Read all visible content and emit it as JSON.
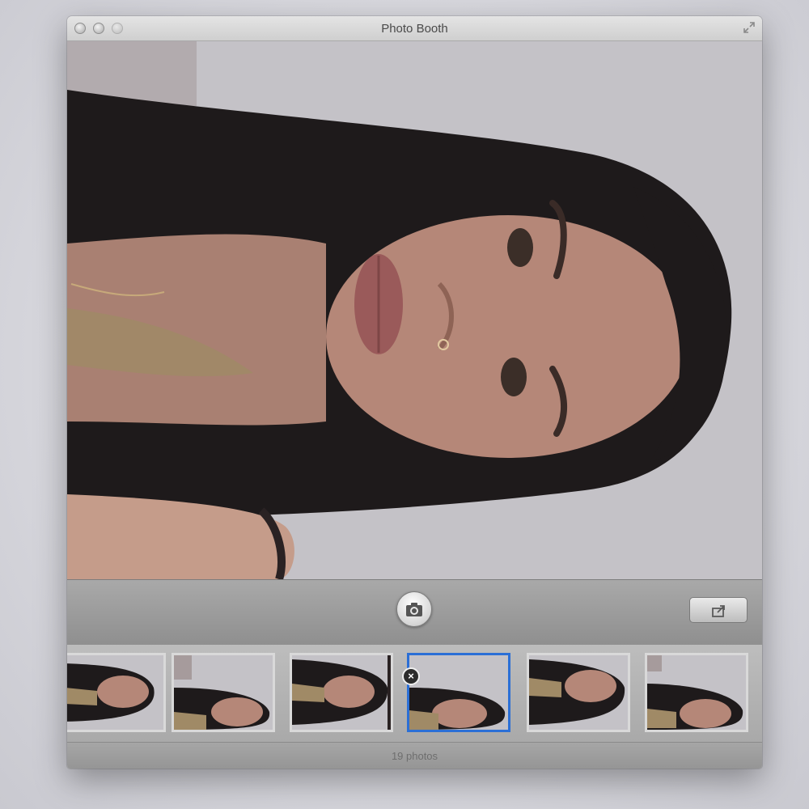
{
  "window": {
    "title": "Photo Booth",
    "controls": [
      "close-button",
      "minimize-button",
      "zoom-button",
      "fullscreen-button"
    ]
  },
  "toolbar": {
    "shutter_icon": "camera-icon",
    "share_icon": "share-icon"
  },
  "filmstrip": {
    "thumbnails": [
      {
        "selected": false
      },
      {
        "selected": false
      },
      {
        "selected": false
      },
      {
        "selected": true,
        "delete_badge": "×"
      },
      {
        "selected": false
      },
      {
        "selected": false
      }
    ]
  },
  "status": {
    "photo_count": "19 photos"
  },
  "colors": {
    "selection": "#2b6fd6",
    "toolbar": "#9a9a9a"
  }
}
